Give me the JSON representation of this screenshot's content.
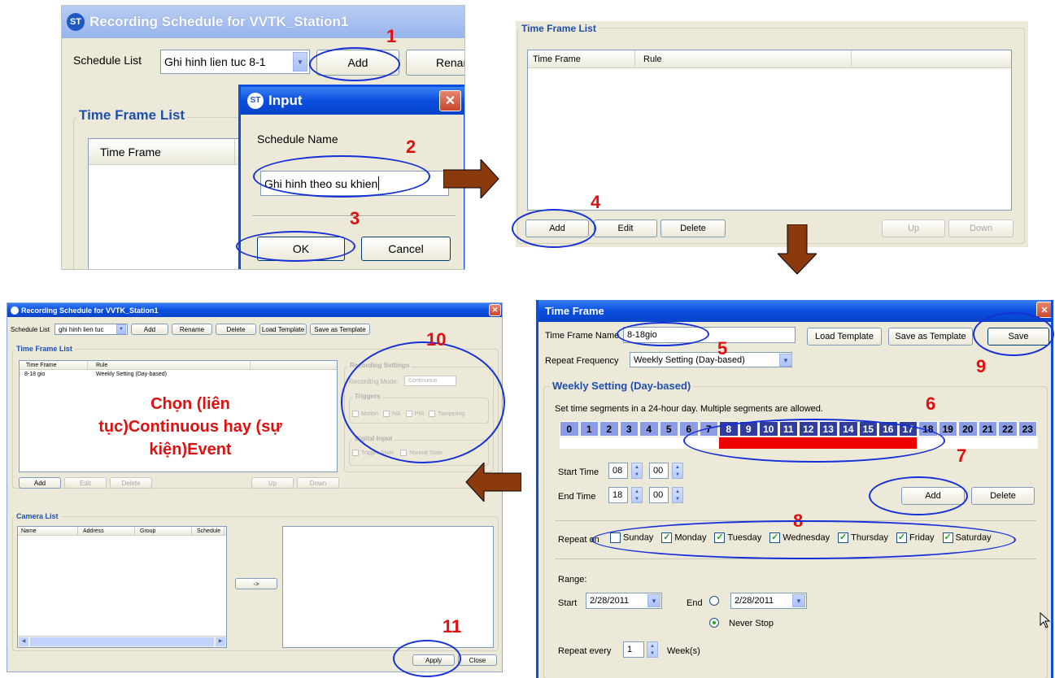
{
  "p1": {
    "title": "Recording Schedule for VVTK_Station1",
    "schedule_list_label": "Schedule List",
    "schedule_value": "Ghi hinh lien tuc 8-1",
    "add": "Add",
    "rename": "Renam",
    "time_frame_list": "Time Frame List",
    "col_time_frame": "Time Frame"
  },
  "dialog": {
    "title": "Input",
    "label": "Schedule Name",
    "value": "Ghi hinh theo su khien",
    "ok": "OK",
    "cancel": "Cancel"
  },
  "p2": {
    "title": "Time Frame List",
    "columns": [
      "Time Frame",
      "Rule"
    ],
    "add": "Add",
    "edit": "Edit",
    "delete": "Delete",
    "up": "Up",
    "down": "Down"
  },
  "p3": {
    "title": "Recording Schedule for VVTK_Station1",
    "schedule_list_label": "Schedule List",
    "schedule_value": "ghi hinh lien tuc",
    "buttons": [
      "Add",
      "Rename",
      "Delete",
      "Load Template",
      "Save as Template"
    ],
    "time_frame_list": "Time Frame List",
    "columns": [
      "Time Frame",
      "Rule"
    ],
    "row": {
      "time_frame": "8-18 gio",
      "rule": "Weekly Setting (Day-based)"
    },
    "overlay_text": "Chọn (liên tục)Continuous hay (sự kiện)Event",
    "recording_settings": "Recording Settings",
    "recording_mode_label": "Recording Mode:",
    "recording_mode_value": "Continuous",
    "triggers": "Triggers",
    "trigger_items": [
      "Motion",
      "IVA",
      "PIR",
      "Tampering"
    ],
    "digital_input": "Digital Input",
    "digital_items": [
      "Trigger State",
      "Normal State"
    ],
    "list_buttons": [
      "Add",
      "Edit",
      "Delete",
      "Up",
      "Down"
    ],
    "camera_list": "Camera List",
    "camera_columns": [
      "Name",
      "Address",
      "Group",
      "Schedule"
    ],
    "arrow_btn": "->",
    "apply": "Apply",
    "close": "Close"
  },
  "p4": {
    "title": "Time Frame",
    "name_label": "Time Frame Name",
    "name_value": "8-18gio",
    "load_template": "Load Template",
    "save_template": "Save as Template",
    "save": "Save",
    "repeat_label": "Repeat Frequency",
    "repeat_value": "Weekly Setting (Day-based)",
    "weekly_title": "Weekly Setting (Day-based)",
    "hint": "Set time segments in a 24-hour day. Multiple segments are allowed.",
    "hours": [
      "0",
      "1",
      "2",
      "3",
      "4",
      "5",
      "6",
      "7",
      "8",
      "9",
      "10",
      "11",
      "12",
      "13",
      "14",
      "15",
      "16",
      "17",
      "18",
      "19",
      "20",
      "21",
      "22",
      "23"
    ],
    "selected_hours": [
      8,
      18
    ],
    "start_label": "Start Time",
    "start_h": "08",
    "start_m": "00",
    "end_label": "End Time",
    "end_h": "18",
    "end_m": "00",
    "add": "Add",
    "delete": "Delete",
    "repeat_on": "Repeat on",
    "days": [
      {
        "name": "Sunday",
        "checked": false
      },
      {
        "name": "Monday",
        "checked": true
      },
      {
        "name": "Tuesday",
        "checked": true
      },
      {
        "name": "Wednesday",
        "checked": true
      },
      {
        "name": "Thursday",
        "checked": true
      },
      {
        "name": "Friday",
        "checked": true
      },
      {
        "name": "Saturday",
        "checked": true
      }
    ],
    "range": "Range:",
    "start": "Start",
    "start_date": "2/28/2011",
    "end": "End",
    "end_date": "2/28/2011",
    "never_stop": "Never Stop",
    "repeat_every": "Repeat every",
    "repeat_every_value": "1",
    "weeks": "Week(s)"
  },
  "steps": [
    "1",
    "2",
    "3",
    "4",
    "5",
    "6",
    "7",
    "8",
    "9",
    "10",
    "11"
  ],
  "colors": {
    "annotation_red": "#e01010",
    "ring_blue": "#1530d8",
    "arrow_brown": "#8b3a0e"
  }
}
